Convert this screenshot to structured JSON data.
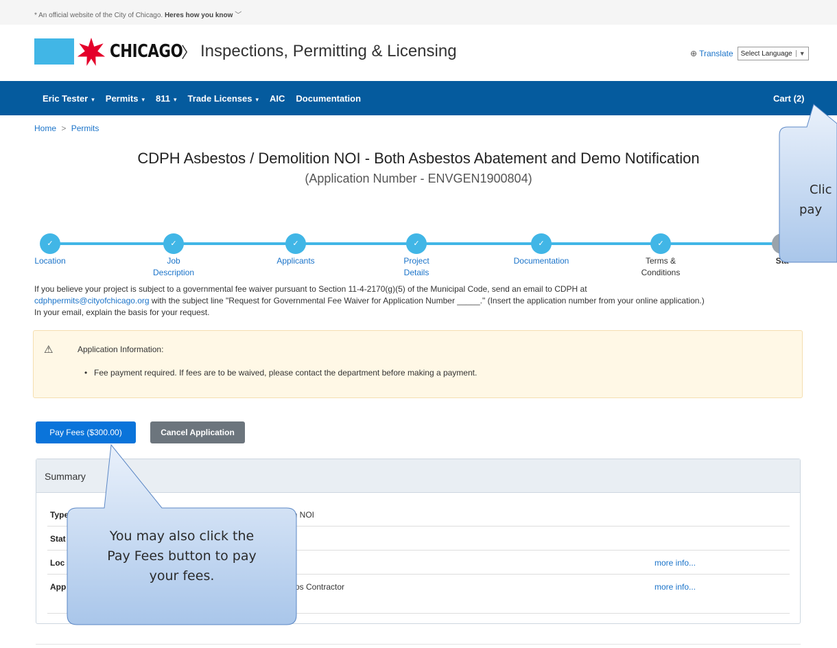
{
  "official_bar": {
    "text": "An official website of the City of Chicago.",
    "link": "Heres how you know"
  },
  "brand": {
    "name": "CHICAGO",
    "separator": "〉",
    "subtitle": "Inspections, Permitting & Licensing"
  },
  "translate": {
    "label": "Translate",
    "select_value": "Select Language"
  },
  "nav": {
    "items": [
      {
        "label": "Eric Tester",
        "dropdown": true
      },
      {
        "label": "Permits",
        "dropdown": true
      },
      {
        "label": "811",
        "dropdown": true
      },
      {
        "label": "Trade Licenses",
        "dropdown": true
      },
      {
        "label": "AIC",
        "dropdown": false
      },
      {
        "label": "Documentation",
        "dropdown": false
      }
    ],
    "cart": "Cart (2)"
  },
  "breadcrumb": {
    "home": "Home",
    "separator": ">",
    "current": "Permits"
  },
  "page": {
    "title": "CDPH Asbestos / Demolition NOI - Both Asbestos Abatement and Demo Notification",
    "subtitle": "(Application Number - ENVGEN1900804)"
  },
  "steps": [
    {
      "line1": "Location",
      "line2": "",
      "done": true
    },
    {
      "line1": "Job",
      "line2": "Description",
      "done": true
    },
    {
      "line1": "Applicants",
      "line2": "",
      "done": true
    },
    {
      "line1": "Project",
      "line2": "Details",
      "done": true
    },
    {
      "line1": "Documentation",
      "line2": "",
      "done": true
    },
    {
      "line1": "Terms &",
      "line2": "Conditions",
      "done": true
    },
    {
      "line1": "Sta",
      "line2": "",
      "done": false
    }
  ],
  "waiver": {
    "part1": "If you believe your project is subject to a governmental fee waiver pursuant to Section 11-4-2170(g)(5) of the Municipal Code, send an email to CDPH at",
    "email": "cdphpermits@cityofchicago.org",
    "part2": " with the subject line \"Request for Governmental Fee Waiver for Application Number _____.\" (Insert the application number from your online application.)",
    "part3": "In your email, explain the basis for your request."
  },
  "alert": {
    "title": "Application Information:",
    "item": "Fee payment required. If fees are to be waived, please contact the department before making a payment."
  },
  "buttons": {
    "pay": "Pay Fees ($300.00)",
    "cancel": "Cancel Application"
  },
  "summary": {
    "header": "Summary",
    "rows": [
      {
        "key": "Type",
        "value": "tion NOI",
        "more": ""
      },
      {
        "key": "Stat",
        "value": "",
        "more": ""
      },
      {
        "key": "Loc",
        "value": "",
        "more": "more info..."
      },
      {
        "key": "App",
        "value": "estos Contractor",
        "more": "more info..."
      }
    ]
  },
  "callouts": {
    "cart_callout": {
      "line1": "Clic",
      "line2": "pay "
    },
    "pay_callout": {
      "line1": "You may also click the",
      "line2": "Pay Fees button to pay",
      "line3": "your fees."
    }
  },
  "colors": {
    "nav_bg": "#055b9e",
    "accent": "#41b6e6",
    "star": "#e4002b",
    "pay_button": "#0a74da",
    "cancel_button": "#6c757d"
  }
}
